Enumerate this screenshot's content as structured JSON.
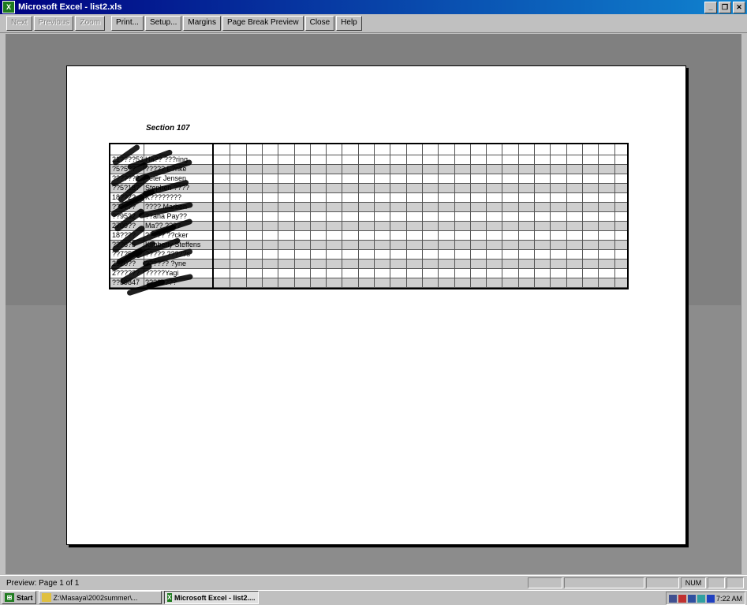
{
  "window": {
    "title": "Microsoft Excel - list2.xls",
    "app_icon": "excel-icon",
    "controls": [
      "minimize-icon",
      "restore-icon",
      "close-icon"
    ]
  },
  "toolbar": {
    "buttons": [
      {
        "label": "Next",
        "enabled": false
      },
      {
        "label": "Previous",
        "enabled": false
      },
      {
        "label": "Zoom",
        "enabled": false
      },
      {
        "label": "Print...",
        "enabled": true
      },
      {
        "label": "Setup...",
        "enabled": true
      },
      {
        "label": "Margins",
        "enabled": true
      },
      {
        "label": "Page Break Preview",
        "enabled": true
      },
      {
        "label": "Close",
        "enabled": true
      },
      {
        "label": "Help",
        "enabled": true
      }
    ]
  },
  "page": {
    "section_title": "Section 107",
    "rows": [
      {
        "id": "21????53",
        "name": "Ha?? ???ring"
      },
      {
        "id": "?5?5??",
        "name": "????? F?nke"
      },
      {
        "id": "??????2",
        "name": "?eter Jensen"
      },
      {
        "id": "??5?18?",
        "name": "Stephen ????"
      },
      {
        "id": "18??2?",
        "name": "K????????"
      },
      {
        "id": "??????",
        "name": "???? Marben"
      },
      {
        "id": "??9532",
        "name": "??ana Pay??"
      },
      {
        "id": "2709??",
        "name": "Ma?? ????"
      },
      {
        "id": "18????",
        "name": "????? ??cker"
      },
      {
        "id": "???6?5",
        "name": "Kimberly Steffens"
      },
      {
        "id": "??7?588",
        "name": "????? ?????s"
      },
      {
        "id": "2920??",
        "name": "?????? ?yne"
      },
      {
        "id": "2??????",
        "name": "?????Yagi"
      },
      {
        "id": "??59847",
        "name": "????????"
      }
    ],
    "blank_columns": 26
  },
  "status": {
    "text": "Preview: Page 1 of 1",
    "num_indicator": "NUM"
  },
  "taskbar": {
    "start_label": "Start",
    "tasks": [
      {
        "label": "Z:\\Masaya\\2002summer\\...",
        "active": false
      },
      {
        "label": "Microsoft Excel - list2....",
        "active": true
      }
    ],
    "clock": "7:22 AM"
  }
}
